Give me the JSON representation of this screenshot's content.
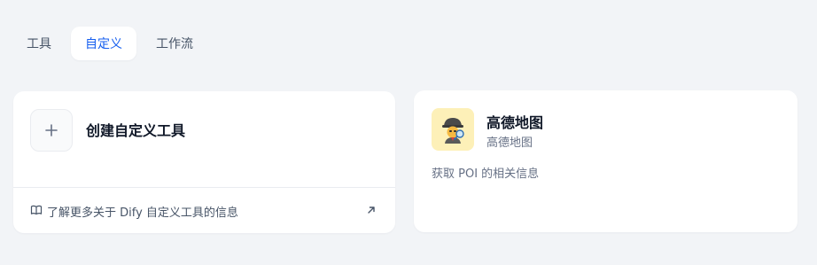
{
  "tabs": [
    {
      "label": "工具",
      "active": false
    },
    {
      "label": "自定义",
      "active": true
    },
    {
      "label": "工作流",
      "active": false
    }
  ],
  "create_card": {
    "title": "创建自定义工具",
    "plus_icon": "plus-icon",
    "learn_more": "了解更多关于 Dify 自定义工具的信息",
    "book_icon": "book-open-icon",
    "arrow_icon": "arrow-up-right-icon"
  },
  "tool_card": {
    "icon": "detective-emoji-icon",
    "name": "高德地图",
    "author": "高德地图",
    "description": "获取 POI 的相关信息"
  },
  "colors": {
    "background": "#f2f4f7",
    "accent": "#155eef",
    "card": "#ffffff",
    "icon_bg": "#fdf0b8"
  }
}
